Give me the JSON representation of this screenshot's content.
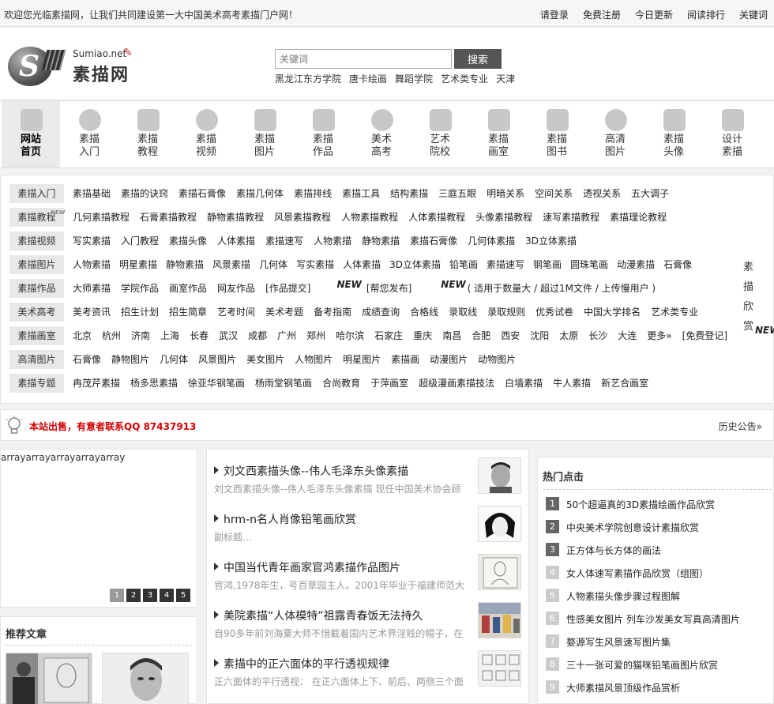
{
  "topbar": {
    "welcome": "欢迎您光临素描网，让我们共同建设第一大中国美术高考素描门户网！",
    "links": [
      "请登录",
      "免费注册",
      "今日更新",
      "阅读排行",
      "关键词"
    ]
  },
  "logo": {
    "net": "Sumiao.net",
    "cn": "素描网"
  },
  "search": {
    "placeholder": "关键词",
    "button": "搜索",
    "hot_keywords": [
      "黑龙江东方学院",
      "唐卡绘画",
      "舞蹈学院",
      "艺术类专业",
      "天津"
    ]
  },
  "nav": [
    {
      "line1": "网站",
      "line2": "首页",
      "icon": "house-icon"
    },
    {
      "line1": "素描",
      "line2": "入门",
      "icon": "globe-icon"
    },
    {
      "line1": "素描",
      "line2": "教程",
      "icon": "folder-icon"
    },
    {
      "line1": "素描",
      "line2": "视频",
      "icon": "play-icon"
    },
    {
      "line1": "素描",
      "line2": "图片",
      "icon": "photos-icon"
    },
    {
      "line1": "素描",
      "line2": "作品",
      "icon": "brush-icon"
    },
    {
      "line1": "美术",
      "line2": "高考",
      "icon": "exam-icon"
    },
    {
      "line1": "艺术",
      "line2": "院校",
      "icon": "cow-icon"
    },
    {
      "line1": "素描",
      "line2": "画室",
      "icon": "studio-icon"
    },
    {
      "line1": "素描",
      "line2": "图书",
      "icon": "books-icon"
    },
    {
      "line1": "高清",
      "line2": "图片",
      "icon": "balloon-icon"
    },
    {
      "line1": "素描",
      "line2": "头像",
      "icon": "bust-icon"
    },
    {
      "line1": "设计",
      "line2": "素描",
      "icon": "building-icon"
    }
  ],
  "categories": [
    {
      "label": "素描入门",
      "links": [
        "素描基础",
        "素描的诀窍",
        "素描石膏像",
        "素描几何体",
        "素描排线",
        "素描工具",
        "结构素描",
        "三庭五眼",
        "明暗关系",
        "空间关系",
        "透视关系",
        "五大调子"
      ]
    },
    {
      "label": "素描教程",
      "links": [
        "几何素描教程",
        "石膏素描教程",
        "静物素描教程",
        "风景素描教程",
        "人物素描教程",
        "人体素描教程",
        "头像素描教程",
        "速写素描教程",
        "素描理论教程"
      ]
    },
    {
      "label": "素描视频",
      "links": [
        "写实素描",
        "入门教程",
        "素描头像",
        "人体素描",
        "素描速写",
        "人物素描",
        "静物素描",
        "素描石膏像",
        "几何体素描",
        "3D立体素描"
      ]
    },
    {
      "label": "素描图片",
      "links": [
        "人物素描",
        "明星素描",
        "静物素描",
        "风景素描",
        "几何体",
        "写实素描",
        "人体素描",
        "3D立体素描",
        "铅笔画",
        "素描速写",
        "钢笔画",
        "圆珠笔画",
        "动漫素描",
        "石膏像"
      ]
    },
    {
      "label": "素描作品",
      "links": [
        "大师素描",
        "学院作品",
        "画室作品",
        "网友作品",
        "[作品提交]",
        "[帮您发布]",
        "( 适用于数量大 / 超过1M文件 / 上传慢用户 )"
      ]
    },
    {
      "label": "美术高考",
      "links": [
        "美考资讯",
        "招生计划",
        "招生简章",
        "艺考时间",
        "美术考题",
        "备考指南",
        "成绩查询",
        "合格线",
        "录取线",
        "录取规则",
        "优秀试卷",
        "中国大学排名",
        "艺术类专业"
      ]
    },
    {
      "label": "素描画室",
      "links": [
        "北京",
        "杭州",
        "济南",
        "上海",
        "长春",
        "武汉",
        "成都",
        "广州",
        "郑州",
        "哈尔滨",
        "石家庄",
        "重庆",
        "南昌",
        "合肥",
        "西安",
        "沈阳",
        "太原",
        "长沙",
        "大连",
        "更多»",
        "[免费登记]"
      ]
    },
    {
      "label": "高清图片",
      "links": [
        "石膏像",
        "静物图片",
        "几何体",
        "风景图片",
        "美女图片",
        "人物图片",
        "明星图片",
        "素描画",
        "动漫图片",
        "动物图片"
      ]
    },
    {
      "label": "素描专题",
      "links": [
        "冉茂芹素描",
        "杨多思素描",
        "徐亚华钢笔画",
        "杨雨堂钢笔画",
        "合尚教育",
        "于萍画室",
        "超级漫画素描技法",
        "白墙素描",
        "牛人素描",
        "新艺合画室"
      ]
    }
  ],
  "new_tag": "NEW",
  "vertical_text": "素描欣赏",
  "notice": {
    "text": "本站出售，有意者联系QQ 87437913",
    "more": "历史公告»"
  },
  "slider": {
    "text": "arrayarrayarrayarrayarray",
    "pages": [
      "1",
      "2",
      "3",
      "4",
      "5"
    ]
  },
  "recommend": {
    "title": "推荐文章"
  },
  "articles": [
    {
      "title": "刘文西素描头像--伟人毛泽东头像素描",
      "desc": "刘文西素描头像--伟人毛泽东头像素描 现任中国美术协会顾"
    },
    {
      "title": "hrm-n名人肖像铅笔画欣赏",
      "desc": "副标题..."
    },
    {
      "title": "中国当代青年画家官鸿素描作品图片",
      "desc": "官鸿,1978年生，号百草园主人。2001年毕业于福建师范大"
    },
    {
      "title": "美院素描“人体模特”祖露青春饭无法持久",
      "desc": "自90多年前刘海粟大师不惜截着国内艺术界淫贱的帽子，在"
    },
    {
      "title": "素描中的正六面体的平行透视规律",
      "desc": "正六面体的平行透视： 在正六面体上下、前后、两侧三个面"
    }
  ],
  "hot": {
    "title": "热门点击",
    "items": [
      {
        "num": "1",
        "text": "50个超逼真的3D素描绘画作品欣赏"
      },
      {
        "num": "2",
        "text": "中央美术学院创意设计素描欣赏"
      },
      {
        "num": "3",
        "text": "正方体与长方体的画法"
      },
      {
        "num": "4",
        "text": "女人体速写素描作品欣赏（组图）"
      },
      {
        "num": "5",
        "text": "人物素描头像步骤过程图解"
      },
      {
        "num": "6",
        "text": "性感美女图片 列车沙发美女写真高清图片"
      },
      {
        "num": "7",
        "text": "婺源写生风景速写图片集"
      },
      {
        "num": "8",
        "text": "三十一张可爱的猫咪铅笔画图片欣赏"
      },
      {
        "num": "9",
        "text": "大师素描风景顶级作品赏析"
      }
    ]
  }
}
